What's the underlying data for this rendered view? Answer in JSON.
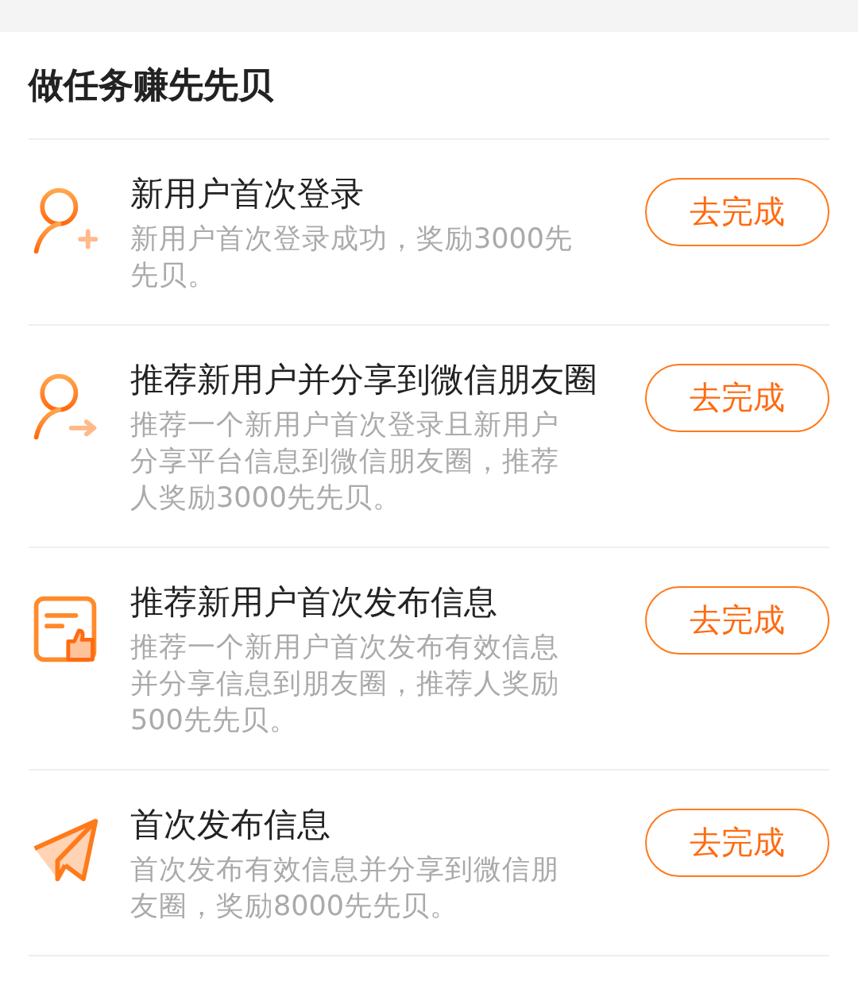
{
  "section_title": "做任务赚先先贝",
  "tasks": [
    {
      "kind": "user-plus",
      "title": "新用户首次登录",
      "description": "新用户首次登录成功，奖励3000先先贝。",
      "button": "去完成"
    },
    {
      "kind": "user-arrow",
      "title": "推荐新用户并分享到微信朋友圈",
      "description": "推荐一个新用户首次登录且新用户分享平台信息到微信朋友圈，推荐人奖励3000先先贝。",
      "button": "去完成"
    },
    {
      "kind": "note-thumb",
      "title": "推荐新用户首次发布信息",
      "description": "推荐一个新用户首次发布有效信息并分享信息到朋友圈，推荐人奖励500先先贝。",
      "button": "去完成"
    },
    {
      "kind": "paper-plane",
      "title": "首次发布信息",
      "description": "首次发布有效信息并分享到微信朋友圈，奖励8000先先贝。",
      "button": "去完成"
    }
  ]
}
